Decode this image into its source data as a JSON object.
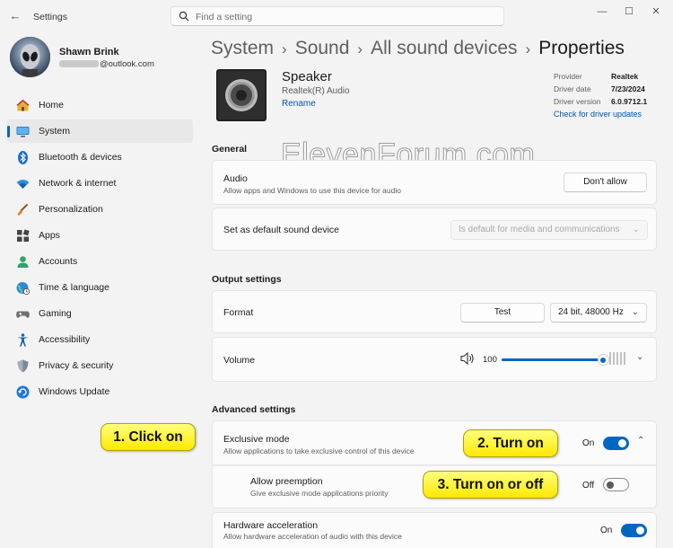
{
  "app": {
    "title": "Settings"
  },
  "search": {
    "placeholder": "Find a setting"
  },
  "window_controls": {
    "minimize": "—",
    "maximize": "☐",
    "close": "✕"
  },
  "profile": {
    "name": "Shawn Brink",
    "email_suffix": "@outlook.com"
  },
  "nav": {
    "items": [
      {
        "label": "Home",
        "icon": "home-icon"
      },
      {
        "label": "System",
        "icon": "monitor-icon",
        "active": true
      },
      {
        "label": "Bluetooth & devices",
        "icon": "bluetooth-icon"
      },
      {
        "label": "Network & internet",
        "icon": "wifi-icon"
      },
      {
        "label": "Personalization",
        "icon": "brush-icon"
      },
      {
        "label": "Apps",
        "icon": "apps-icon"
      },
      {
        "label": "Accounts",
        "icon": "person-icon"
      },
      {
        "label": "Time & language",
        "icon": "globe-clock-icon"
      },
      {
        "label": "Gaming",
        "icon": "gamepad-icon"
      },
      {
        "label": "Accessibility",
        "icon": "accessibility-icon"
      },
      {
        "label": "Privacy & security",
        "icon": "shield-icon"
      },
      {
        "label": "Windows Update",
        "icon": "update-icon"
      }
    ]
  },
  "breadcrumb": {
    "items": [
      "System",
      "Sound",
      "All sound devices",
      "Properties"
    ],
    "separator": "›"
  },
  "device": {
    "name": "Speaker",
    "subtitle": "Realtek(R) Audio",
    "rename_label": "Rename",
    "provider_label": "Provider",
    "provider_value": "Realtek",
    "date_label": "Driver date",
    "date_value": "7/23/2024",
    "version_label": "Driver version",
    "version_value": "6.0.9712.1",
    "check_updates_label": "Check for driver updates"
  },
  "watermark": "ElevenForum.com",
  "general": {
    "heading": "General",
    "audio": {
      "title": "Audio",
      "desc": "Allow apps and Windows to use this device for audio",
      "button": "Don't allow"
    },
    "default_device": {
      "title": "Set as default sound device",
      "value": "Is default for media and communications"
    }
  },
  "output": {
    "heading": "Output settings",
    "format": {
      "title": "Format",
      "test_button": "Test",
      "value": "24 bit, 48000 Hz"
    },
    "volume": {
      "title": "Volume",
      "value": "100",
      "level": 1.0
    }
  },
  "advanced": {
    "heading": "Advanced settings",
    "exclusive": {
      "title": "Exclusive mode",
      "desc": "Allow applications to take exclusive control of this device",
      "state": "On"
    },
    "preemption": {
      "title": "Allow preemption",
      "desc": "Give exclusive mode applications priority",
      "state": "Off"
    },
    "hw_accel": {
      "title": "Hardware acceleration",
      "desc": "Allow hardware acceleration of audio with this device",
      "state": "On"
    }
  },
  "callouts": {
    "one": "1. Click on",
    "two": "2. Turn on",
    "three": "3. Turn on or off"
  },
  "colors": {
    "accent": "#0067c0",
    "link": "#0056b3",
    "callout_yellow": "#ffee00"
  }
}
